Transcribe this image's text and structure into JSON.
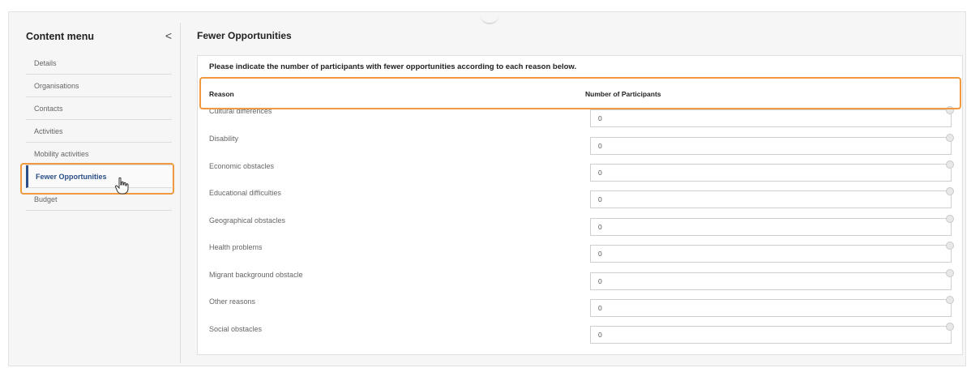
{
  "sidebar": {
    "title": "Content menu",
    "collapse_glyph": "<",
    "items": [
      {
        "label": "Details",
        "active": false
      },
      {
        "label": "Organisations",
        "active": false
      },
      {
        "label": "Contacts",
        "active": false
      },
      {
        "label": "Activities",
        "active": false
      },
      {
        "label": "Mobility activities",
        "active": false
      },
      {
        "label": "Fewer Opportunities",
        "active": true
      },
      {
        "label": "Budget",
        "active": false
      }
    ]
  },
  "main": {
    "title": "Fewer Opportunities",
    "instruction": "Please indicate the number of participants with fewer opportunities according to each reason below.",
    "columns": {
      "reason": "Reason",
      "count": "Number of Participants"
    },
    "rows": [
      {
        "reason": "Cultural differences",
        "value": "0"
      },
      {
        "reason": "Disability",
        "value": "0"
      },
      {
        "reason": "Economic obstacles",
        "value": "0"
      },
      {
        "reason": "Educational difficulties",
        "value": "0"
      },
      {
        "reason": "Geographical obstacles",
        "value": "0"
      },
      {
        "reason": "Health problems",
        "value": "0"
      },
      {
        "reason": "Migrant background obstacle",
        "value": "0"
      },
      {
        "reason": "Other reasons",
        "value": "0"
      },
      {
        "reason": "Social obstacles",
        "value": "0"
      }
    ]
  },
  "colors": {
    "accent": "#2a4f86",
    "highlight": "#f0993e"
  },
  "icons": {
    "collapse": "chevron-left-icon",
    "cursor": "hand-pointer-icon"
  }
}
